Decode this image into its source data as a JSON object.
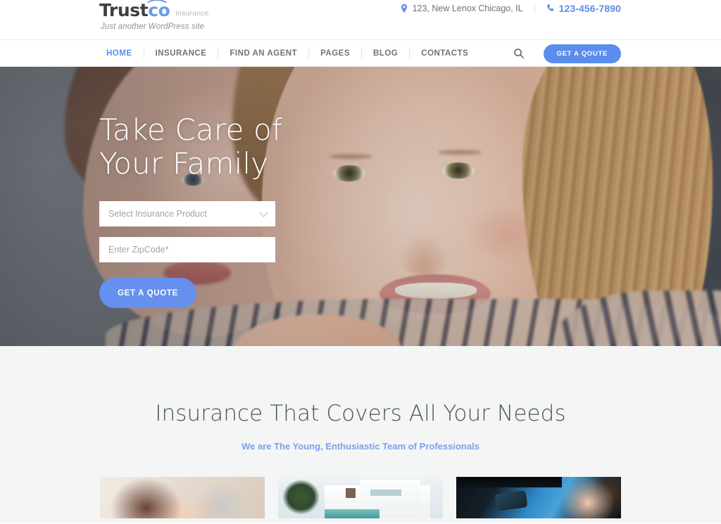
{
  "header": {
    "logo": {
      "brand_part1": "Trust",
      "brand_part2": "co",
      "subtitle": "insurance",
      "roof_icon": "house-roof-icon"
    },
    "tagline": "Just another WordPress site",
    "address": "123, New Lenox Chicago, IL",
    "phone": "123-456-7890",
    "address_icon": "location-pin-icon",
    "phone_icon": "phone-icon"
  },
  "nav": {
    "items": [
      {
        "label": "HOME",
        "active": true
      },
      {
        "label": "INSURANCE",
        "active": false
      },
      {
        "label": "FIND AN AGENT",
        "active": false
      },
      {
        "label": "PAGES",
        "active": false
      },
      {
        "label": "BLOG",
        "active": false
      },
      {
        "label": "CONTACTS",
        "active": false
      }
    ],
    "search_icon": "search-icon",
    "quote_button": "GET A QOUTE"
  },
  "hero": {
    "title_line1": "Take Care of",
    "title_line2": "Your Family",
    "product_select": {
      "value": "Select Insurance Product",
      "chevron_icon": "chevron-down-icon"
    },
    "zipcode_input": {
      "placeholder": "Enter ZipCode*",
      "value": ""
    },
    "quote_button": "GET A QUOTE"
  },
  "services": {
    "title": "Insurance That Covers All Your Needs",
    "subtitle": "We are The Young, Enthusiastic Team of Professionals",
    "cards": [
      {
        "name": "life-insurance-card",
        "alt": "Couple smiling together"
      },
      {
        "name": "home-insurance-card",
        "alt": "Modern white house with pool"
      },
      {
        "name": "auto-insurance-card",
        "alt": "Woman smiling inside a car"
      }
    ]
  },
  "colors": {
    "accent": "#5b8ded",
    "accent_light": "#7ba0ef",
    "text_dark": "#4e5458",
    "text_muted": "#6f7376",
    "section_bg": "#f4f5f5"
  }
}
